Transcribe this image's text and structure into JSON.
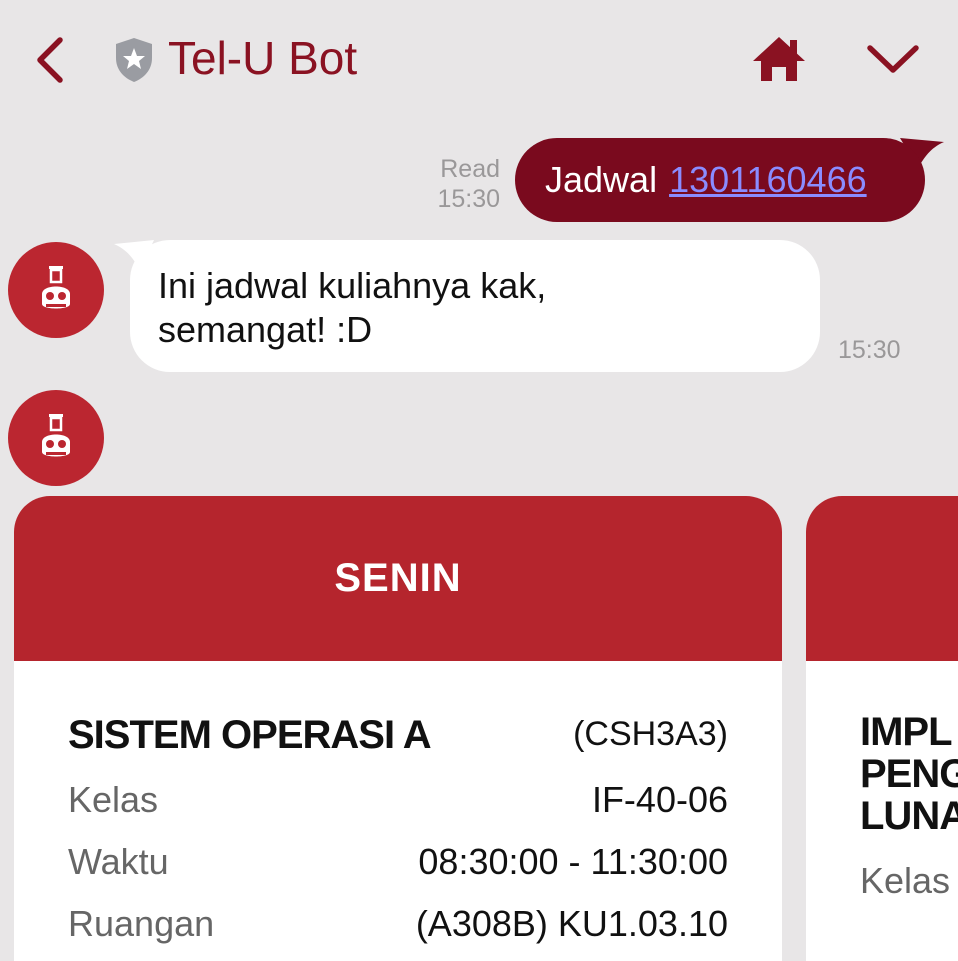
{
  "header": {
    "title": "Tel-U Bot",
    "back_icon": "chevron-left-icon",
    "verified_icon": "shield-star-icon",
    "home_icon": "home-icon",
    "collapse_icon": "chevron-down-icon",
    "accent_color": "#8a1222"
  },
  "messages": {
    "user": {
      "status": "Read",
      "time": "15:30",
      "text": "Jadwal",
      "link": "1301160466",
      "bubble_color": "#7a0a1e"
    },
    "bot": {
      "line1": "Ini jadwal kuliahnya kak,",
      "line2": "semangat! :D",
      "time": "15:30"
    }
  },
  "cards": [
    {
      "day": "SENIN",
      "course_name": "SISTEM OPERASI A",
      "course_code": "(CSH3A3)",
      "rows": [
        {
          "label": "Kelas",
          "value": "IF-40-06"
        },
        {
          "label": "Waktu",
          "value": "08:30:00 - 11:30:00"
        },
        {
          "label": "Ruangan",
          "value": "(A308B) KU1.03.10"
        }
      ]
    },
    {
      "course_name": "IMPL\nPENG\nLUNA",
      "rows": [
        {
          "label": "Kelas"
        }
      ]
    }
  ],
  "colors": {
    "card_header": "#b5252d",
    "background": "#e8e6e7",
    "avatar": "#bb2630"
  }
}
